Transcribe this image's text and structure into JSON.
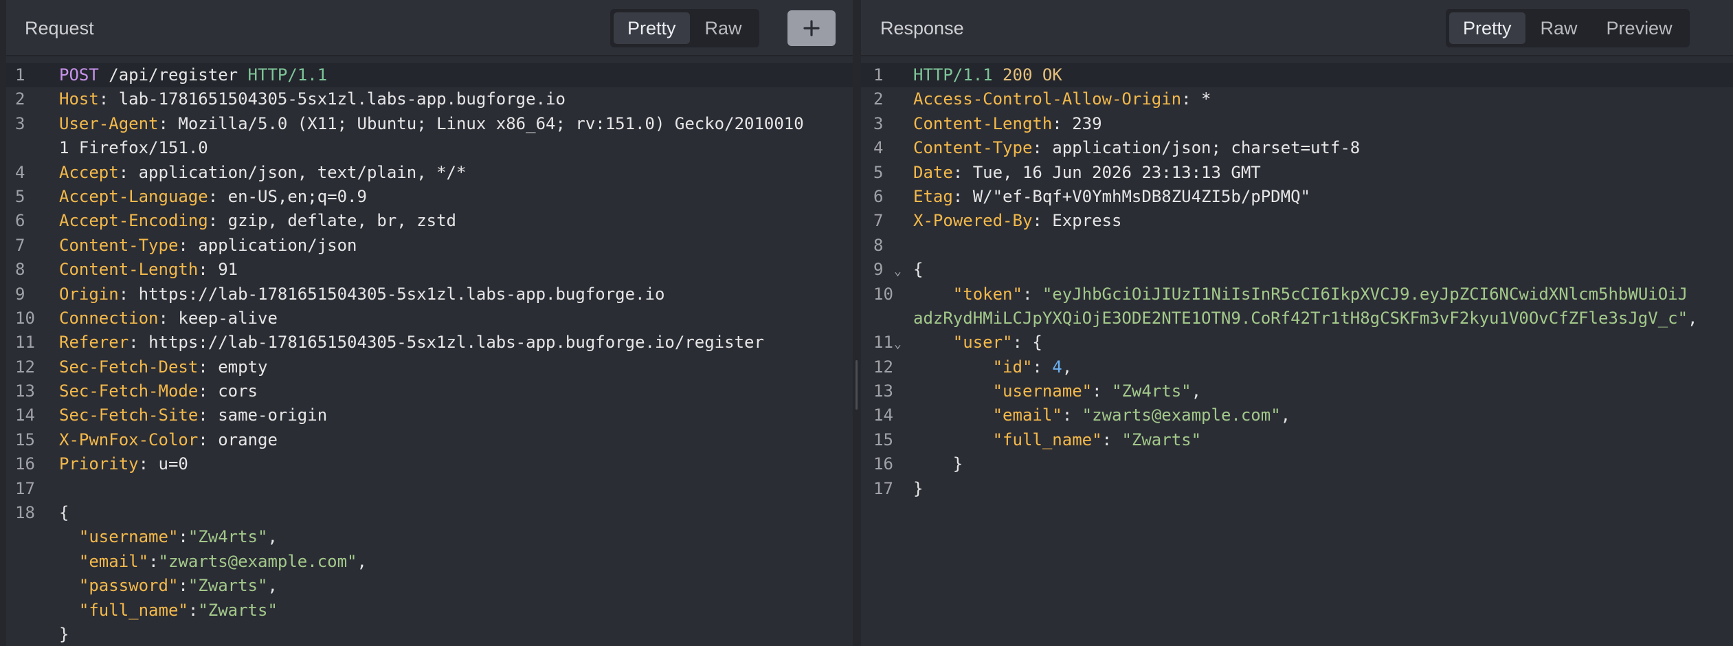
{
  "request": {
    "title": "Request",
    "view_tabs": [
      "Pretty",
      "Raw"
    ],
    "active_tab": "Pretty",
    "add_icon": "plus-icon",
    "line_numbers": [
      "1",
      "2",
      "3",
      "",
      "4",
      "5",
      "6",
      "7",
      "8",
      "9",
      "10",
      "11",
      "12",
      "13",
      "14",
      "15",
      "16",
      "17",
      "18",
      "",
      "",
      "",
      "",
      ""
    ],
    "request_line": {
      "method": "POST",
      "path": " /api/register ",
      "protocol": "HTTP/1.1"
    },
    "headers": [
      {
        "key": "Host",
        "value": "lab-1781651504305-5sx1zl.labs-app.bugforge.io"
      },
      {
        "key": "User-Agent",
        "value": "Mozilla/5.0 (X11; Ubuntu; Linux x86_64; rv:151.0) Gecko/2010010"
      },
      {
        "key": "",
        "value": "1 Firefox/151.0"
      },
      {
        "key": "Accept",
        "value": "application/json, text/plain, */*"
      },
      {
        "key": "Accept-Language",
        "value": "en-US,en;q=0.9"
      },
      {
        "key": "Accept-Encoding",
        "value": "gzip, deflate, br, zstd"
      },
      {
        "key": "Content-Type",
        "value": "application/json"
      },
      {
        "key": "Content-Length",
        "value": "91"
      },
      {
        "key": "Origin",
        "value": "https://lab-1781651504305-5sx1zl.labs-app.bugforge.io"
      },
      {
        "key": "Connection",
        "value": "keep-alive"
      },
      {
        "key": "Referer",
        "value": "https://lab-1781651504305-5sx1zl.labs-app.bugforge.io/register"
      },
      {
        "key": "Sec-Fetch-Dest",
        "value": "empty"
      },
      {
        "key": "Sec-Fetch-Mode",
        "value": "cors"
      },
      {
        "key": "Sec-Fetch-Site",
        "value": "same-origin"
      },
      {
        "key": "X-PwnFox-Color",
        "value": "orange"
      },
      {
        "key": "Priority",
        "value": "u=0"
      }
    ],
    "body": {
      "open": "{",
      "fields": [
        {
          "key": "\"username\"",
          "sep": ":",
          "value": "\"Zw4rts\"",
          "comma": ","
        },
        {
          "key": "\"email\"",
          "sep": ":",
          "value": "\"zwarts@example.com\"",
          "comma": ","
        },
        {
          "key": "\"password\"",
          "sep": ":",
          "value": "\"Zwarts\"",
          "comma": ","
        },
        {
          "key": "\"full_name\"",
          "sep": ":",
          "value": "\"Zwarts\"",
          "comma": ""
        }
      ],
      "close": "}"
    }
  },
  "response": {
    "title": "Response",
    "view_tabs": [
      "Pretty",
      "Raw",
      "Preview"
    ],
    "active_tab": "Pretty",
    "fold_icon": "chevron-down-icon",
    "line_numbers": [
      "1",
      "2",
      "3",
      "4",
      "5",
      "6",
      "7",
      "8",
      "9",
      "10",
      "",
      "11",
      "12",
      "13",
      "14",
      "15",
      "16",
      "17"
    ],
    "status_line": {
      "protocol": "HTTP/1.1",
      "code": " 200 ",
      "text": "OK"
    },
    "headers": [
      {
        "key": "Access-Control-Allow-Origin",
        "value": "*"
      },
      {
        "key": "Content-Length",
        "value": "239"
      },
      {
        "key": "Content-Type",
        "value": "application/json; charset=utf-8"
      },
      {
        "key": "Date",
        "value": "Tue, 16 Jun 2026 23:13:13 GMT"
      },
      {
        "key": "Etag",
        "value": "W/\"ef-Bqf+V0YmhMsDB8ZU4ZI5b/pPDMQ\""
      },
      {
        "key": "X-Powered-By",
        "value": "Express"
      }
    ],
    "body": {
      "open": "{",
      "token_key": "\"token\"",
      "token_value_line1": "\"eyJhbGciOiJIUzI1NiIsInR5cCI6IkpXVCJ9.eyJpZCI6NCwidXNlcm5hbWUiOiJ",
      "token_value_line2": "adzRydHMiLCJpYXQiOjE3ODE2NTE1OTN9.CoRf42Tr1tH8gCSKFm3vF2kyu1V0OvCfZFle3sJgV_c\"",
      "token_comma": ",",
      "user_key": "\"user\"",
      "user_open": "{",
      "user_fields": [
        {
          "key": "\"id\"",
          "value": "4",
          "type": "number",
          "comma": ","
        },
        {
          "key": "\"username\"",
          "value": "\"Zw4rts\"",
          "type": "string",
          "comma": ","
        },
        {
          "key": "\"email\"",
          "value": "\"zwarts@example.com\"",
          "type": "string",
          "comma": ","
        },
        {
          "key": "\"full_name\"",
          "value": "\"Zwarts\"",
          "type": "string",
          "comma": ""
        }
      ],
      "user_close": "}",
      "close": "}"
    }
  }
}
